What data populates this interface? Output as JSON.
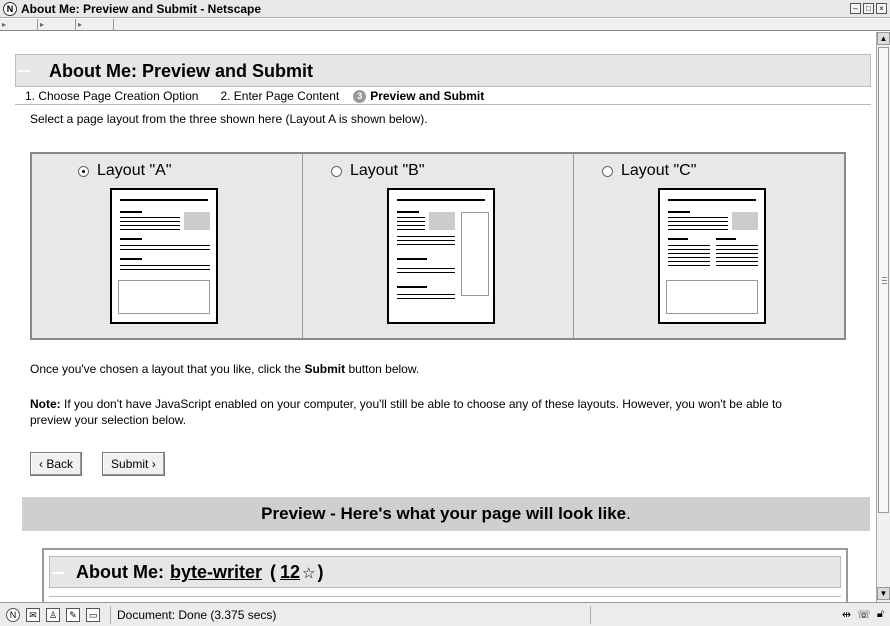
{
  "window": {
    "title": "About Me: Preview and Submit - Netscape",
    "app_icon": "netscape-icon",
    "buttons": [
      "minimize",
      "maximize",
      "close"
    ]
  },
  "header": {
    "title": "About Me: Preview and Submit"
  },
  "steps": [
    {
      "label": "1. Choose Page Creation Option"
    },
    {
      "label": "2. Enter Page Content"
    },
    {
      "num": "3",
      "label": "Preview and Submit"
    }
  ],
  "instruction": "Select a page layout from the three shown here (Layout A is shown below).",
  "layouts": [
    {
      "label": "Layout \"A\"",
      "selected": true
    },
    {
      "label": "Layout \"B\"",
      "selected": false
    },
    {
      "label": "Layout \"C\"",
      "selected": false
    }
  ],
  "note1": {
    "before": "Once you've chosen a layout that you like, click the ",
    "bold": "Submit",
    "after": " button below."
  },
  "note2": {
    "bold": "Note:",
    "text": " If you don't have JavaScript enabled on your computer, you'll still be able to choose any of these layouts. However, you won't be able to preview your selection below."
  },
  "buttons": {
    "back": "‹ Back",
    "submit": "Submit ›"
  },
  "preview": {
    "title": "Preview - Here's what your page will look like",
    "period": "."
  },
  "profile": {
    "prefix": "About Me:",
    "username": "byte-writer",
    "open_paren": "(",
    "rating": "12",
    "star": "☆",
    "close_paren": ")"
  },
  "status": {
    "text": "Document: Done (3.375 secs)"
  },
  "colors": {
    "header_bg": "#e6e6e6",
    "preview_bg": "#cfcfcf",
    "layout_bg": "#e8e8e8"
  }
}
